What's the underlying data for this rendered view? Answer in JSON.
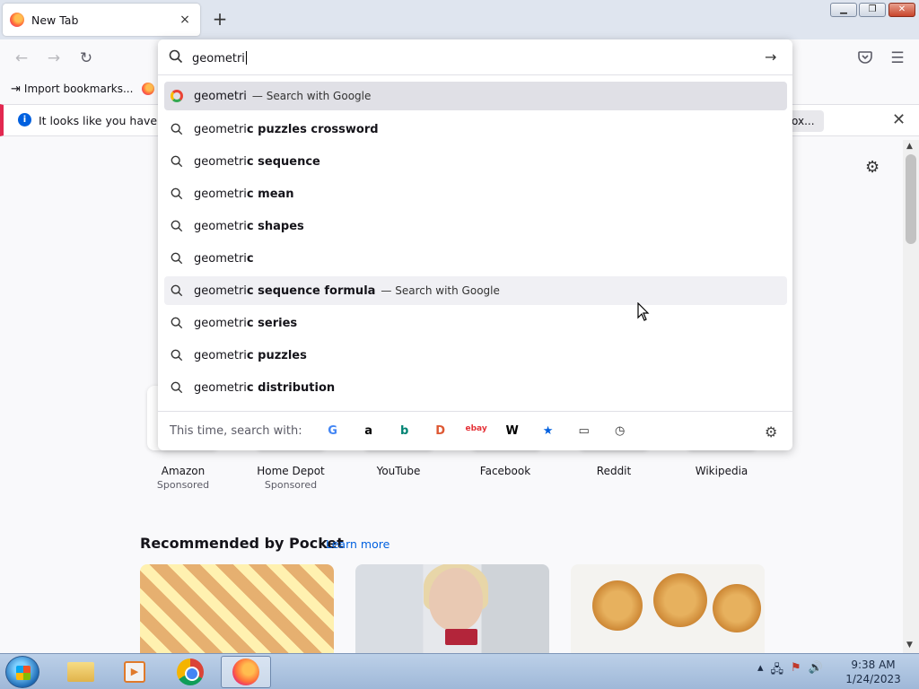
{
  "browser": {
    "tab_title": "New Tab",
    "tab_close": "×",
    "new_tab": "+",
    "bookmarks": [
      {
        "label": "Import bookmarks...",
        "icon": "import-icon"
      },
      {
        "label": "G",
        "icon": "firefox-icon"
      }
    ],
    "notification": {
      "message": "It looks like you haven’t s",
      "button": "ox..."
    }
  },
  "address_bar": {
    "value": "geometri",
    "suggestions": [
      {
        "prefix": "geometri",
        "suffix": "",
        "note": "— Search with Google",
        "icon": "google-icon",
        "state": "selected"
      },
      {
        "prefix": "geometri",
        "suffix": "c puzzles crossword",
        "note": "",
        "icon": "search-icon",
        "state": "normal"
      },
      {
        "prefix": "geometri",
        "suffix": "c sequence",
        "note": "",
        "icon": "search-icon",
        "state": "normal"
      },
      {
        "prefix": "geometri",
        "suffix": "c mean",
        "note": "",
        "icon": "search-icon",
        "state": "normal"
      },
      {
        "prefix": "geometri",
        "suffix": "c shapes",
        "note": "",
        "icon": "search-icon",
        "state": "normal"
      },
      {
        "prefix": "geometri",
        "suffix": "c",
        "note": "",
        "icon": "search-icon",
        "state": "normal"
      },
      {
        "prefix": "geometri",
        "suffix": "c sequence formula",
        "note": "— Search with Google",
        "icon": "search-icon",
        "state": "hover"
      },
      {
        "prefix": "geometri",
        "suffix": "c series",
        "note": "",
        "icon": "search-icon",
        "state": "normal"
      },
      {
        "prefix": "geometri",
        "suffix": "c puzzles",
        "note": "",
        "icon": "search-icon",
        "state": "normal"
      },
      {
        "prefix": "geometri",
        "suffix": "c distribution",
        "note": "",
        "icon": "search-icon",
        "state": "normal"
      }
    ],
    "search_with_label": "This time, search with:",
    "engines": [
      {
        "name": "google-engine-icon",
        "glyph": "G",
        "color": "#4285f4"
      },
      {
        "name": "amazon-engine-icon",
        "glyph": "a",
        "color": "#000000"
      },
      {
        "name": "bing-engine-icon",
        "glyph": "b",
        "color": "#008373"
      },
      {
        "name": "duckduckgo-engine-icon",
        "glyph": "D",
        "color": "#de5833"
      },
      {
        "name": "ebay-engine-icon",
        "glyph": "ebay",
        "color": "#e53238"
      },
      {
        "name": "wikipedia-engine-icon",
        "glyph": "W",
        "color": "#000000"
      },
      {
        "name": "bookmarks-engine-icon",
        "glyph": "★",
        "color": "#0060df"
      },
      {
        "name": "tabs-engine-icon",
        "glyph": "▭",
        "color": "#333333"
      },
      {
        "name": "history-engine-icon",
        "glyph": "◷",
        "color": "#333333"
      }
    ]
  },
  "top_sites": [
    {
      "label": "Amazon",
      "sub": "Sponsored"
    },
    {
      "label": "Home Depot",
      "sub": "Sponsored"
    },
    {
      "label": "YouTube",
      "sub": ""
    },
    {
      "label": "Facebook",
      "sub": ""
    },
    {
      "label": "Reddit",
      "sub": ""
    },
    {
      "label": "Wikipedia",
      "sub": ""
    }
  ],
  "pocket": {
    "title": "Recommended by Pocket",
    "learn_more": "Learn more"
  },
  "taskbar": {
    "time": "9:38 AM",
    "date": "1/24/2023"
  }
}
